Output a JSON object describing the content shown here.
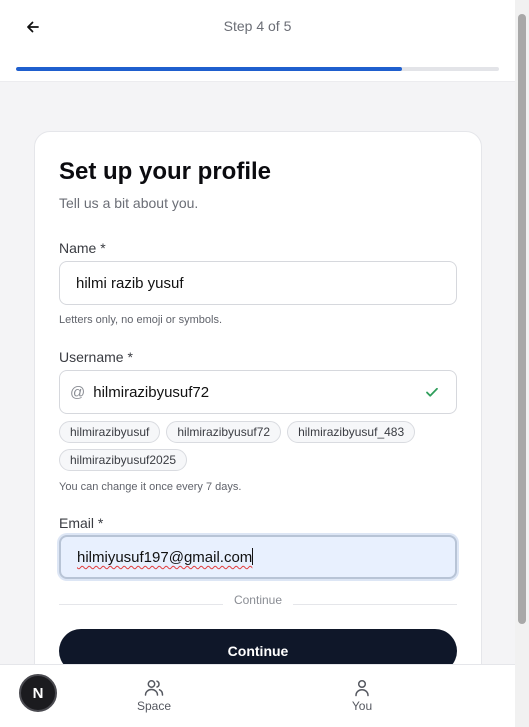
{
  "header": {
    "step_label": "Step 4 of 5",
    "progress_percent": 80
  },
  "form": {
    "title": "Set up your profile",
    "subtitle": "Tell us a bit about you.",
    "name": {
      "label": "Name *",
      "value": "hilmi razib yusuf",
      "hint": "Letters only, no emoji or symbols."
    },
    "username": {
      "label": "Username *",
      "prefix": "@",
      "value": "hilmirazibyusuf72",
      "suggestions": [
        "hilmirazibyusuf",
        "hilmirazibyusuf72",
        "hilmirazibyusuf_483",
        "hilmirazibyusuf2025"
      ],
      "hint": "You can change it once every 7 days."
    },
    "email": {
      "label": "Email *",
      "value": "hilmiyusuf197@gmail.com"
    },
    "divider_label": "Continue",
    "continue_label": "Continue"
  },
  "bottom_nav": {
    "avatar_letter": "N",
    "items": [
      {
        "label": "Space",
        "icon": "users-icon"
      },
      {
        "label": "You",
        "icon": "user-icon"
      }
    ]
  },
  "colors": {
    "accent": "#1f5fce",
    "button": "#0f1729",
    "valid": "#2f9e5b"
  }
}
